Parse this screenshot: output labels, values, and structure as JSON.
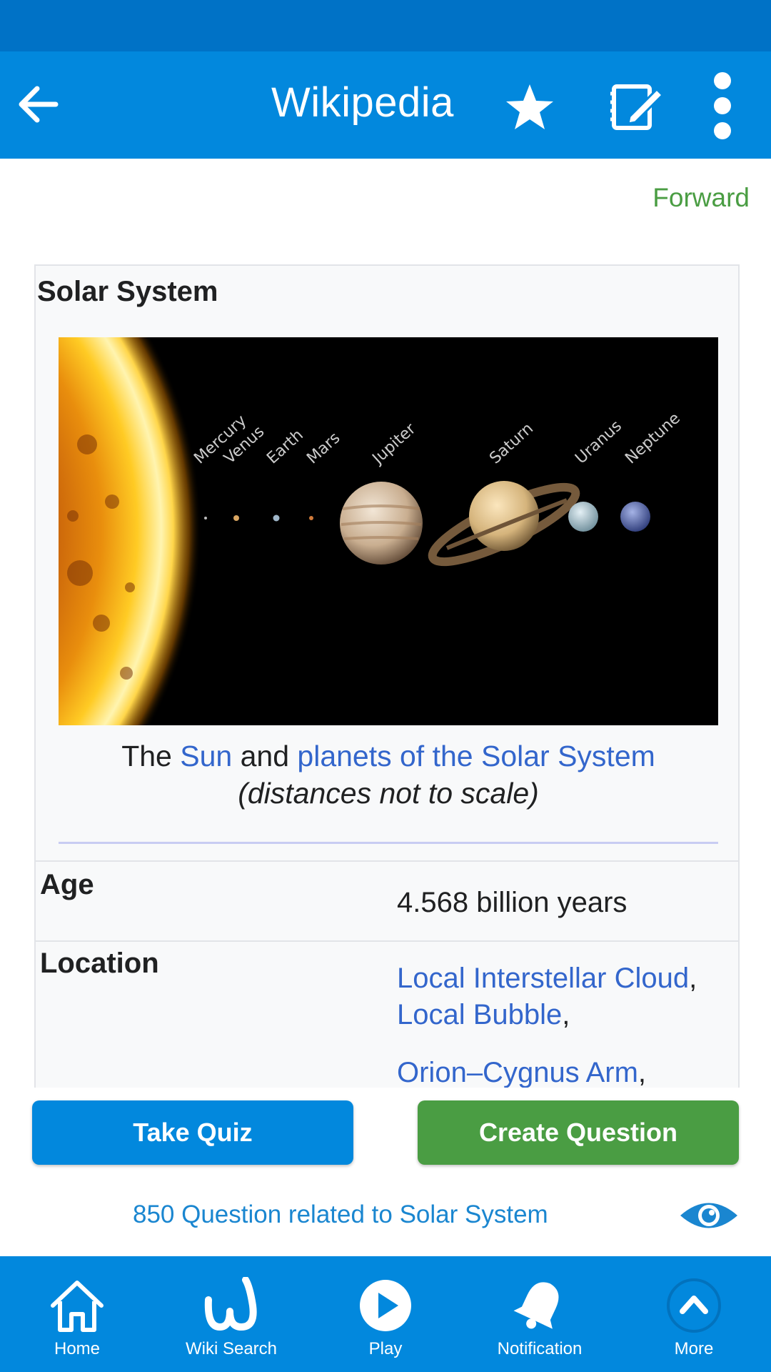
{
  "app": {
    "title": "Wikipedia",
    "forward_label": "Forward"
  },
  "infobox": {
    "title": "Solar System",
    "image": {
      "planet_labels": [
        "Mercury",
        "Venus",
        "Earth",
        "Mars",
        "Jupiter",
        "Saturn",
        "Uranus",
        "Neptune"
      ]
    },
    "caption": {
      "pre": "The ",
      "link1": "Sun",
      "mid": " and ",
      "link2": "planets of the Solar System",
      "note": "(distances not to scale)"
    },
    "rows": [
      {
        "label": "Age",
        "value": "4.568 billion years"
      },
      {
        "label": "Location",
        "links": [
          "Local Interstellar Cloud",
          "Local Bubble",
          "Orion–Cygnus Arm"
        ],
        "separator": ","
      }
    ]
  },
  "actions": {
    "quiz": "Take Quiz",
    "create": "Create Question"
  },
  "related": {
    "text": "850 Question related to Solar System"
  },
  "nav": [
    {
      "label": "Home",
      "icon": "home-icon"
    },
    {
      "label": "Wiki Search",
      "icon": "wiki-w-icon"
    },
    {
      "label": "Play",
      "icon": "play-icon"
    },
    {
      "label": "Notification",
      "icon": "bell-icon"
    },
    {
      "label": "More",
      "icon": "chevron-up-icon"
    }
  ],
  "colors": {
    "status_bar": "#0072c6",
    "app_bar": "#0288dd",
    "quiz_button": "#0288dd",
    "create_button": "#4a9d43",
    "link": "#3366cc",
    "forward": "#4a9d43"
  }
}
